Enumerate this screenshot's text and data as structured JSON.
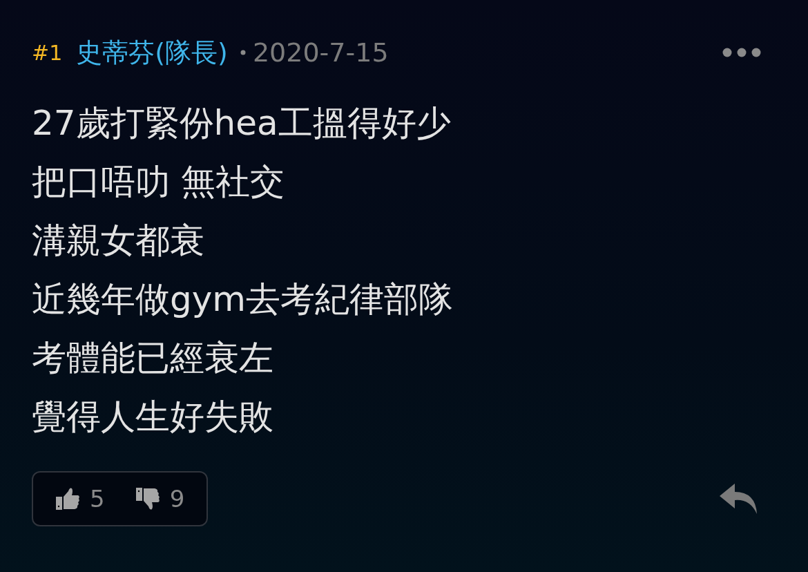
{
  "post": {
    "number": "#1",
    "author": "史蒂芬(隊長)",
    "date": "2020-7-15",
    "lines": [
      "27歲打緊份hea工搵得好少",
      "把口唔叻 無社交",
      "溝親女都衰",
      "近幾年做gym去考紀律部隊",
      "考體能已經衰左",
      "覺得人生好失敗"
    ],
    "likes": "5",
    "dislikes": "9"
  }
}
